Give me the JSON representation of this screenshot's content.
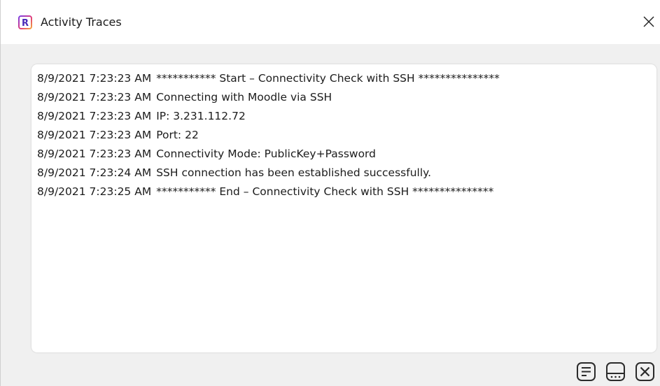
{
  "window": {
    "title": "Activity Traces",
    "logo_letter": "R",
    "icons": {
      "app": "r-logo-icon",
      "close": "close-icon"
    }
  },
  "log": {
    "entries": [
      {
        "timestamp": "8/9/2021 7:23:23 AM",
        "message": "*********** Start – Connectivity Check with SSH ***************"
      },
      {
        "timestamp": "8/9/2021 7:23:23 AM",
        "message": "Connecting with Moodle via SSH"
      },
      {
        "timestamp": "8/9/2021 7:23:23 AM",
        "message": "IP: 3.231.112.72"
      },
      {
        "timestamp": "8/9/2021 7:23:23 AM",
        "message": "Port: 22"
      },
      {
        "timestamp": "8/9/2021 7:23:23 AM",
        "message": "Connectivity Mode: PublicKey+Password"
      },
      {
        "timestamp": "8/9/2021 7:23:24 AM",
        "message": "SSH connection has been established successfully."
      },
      {
        "timestamp": "8/9/2021 7:23:25 AM",
        "message": "*********** End – Connectivity Check with SSH ***************"
      }
    ]
  },
  "footer": {
    "icons": [
      "log-details-icon",
      "status-bar-icon",
      "clear-icon"
    ]
  },
  "colors": {
    "logo_gradient_start": "#7b3fe4",
    "logo_gradient_mid": "#e23b7a",
    "logo_gradient_end": "#f4a63c",
    "icon_stroke": "#2b2b2b",
    "panel_background": "#ffffff",
    "window_background": "#f0f0f0"
  }
}
